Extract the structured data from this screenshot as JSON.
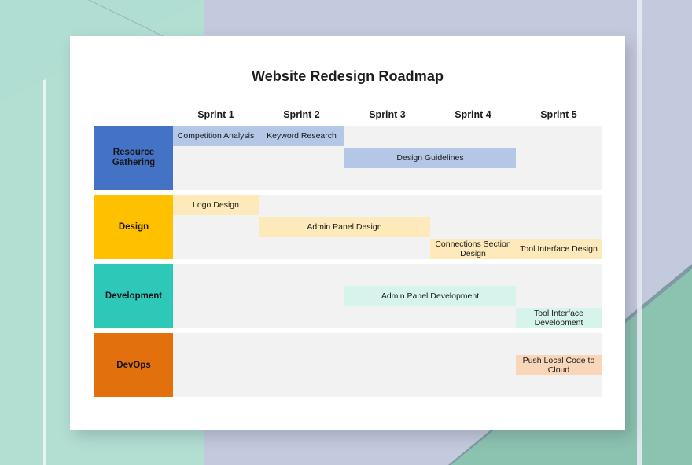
{
  "card": {
    "title": "Website Redesign Roadmap"
  },
  "colors": {
    "background_periwinkle": "#c4cadd",
    "background_mint": "#b3dfd3",
    "background_green_wedge": "#8cc2b0",
    "card_background": "#ffffff",
    "track_background": "#f2f2f2",
    "row_resource_gathering": "#4472c4",
    "row_design": "#ffc000",
    "row_development": "#2ec8b8",
    "row_devops": "#e2700d",
    "bar_resource_gathering": "#b4c7e7",
    "bar_design": "#fde9b9",
    "bar_development": "#d6f3ec",
    "bar_devops": "#fad6b8"
  },
  "chart_data": {
    "type": "bar",
    "title": "Website Redesign Roadmap",
    "xlabel": "",
    "ylabel": "",
    "categories": [
      "Sprint 1",
      "Sprint 2",
      "Sprint 3",
      "Sprint 4",
      "Sprint 5"
    ],
    "legend_position": "none",
    "grid": false,
    "series": [
      {
        "name": "Resource Gathering",
        "color": "#4472c4",
        "bar_color": "#b4c7e7",
        "values": [
          {
            "task": "Competition Analysis",
            "start_sprint": 1,
            "end_sprint": 1,
            "lane": 0
          },
          {
            "task": "Keyword Research",
            "start_sprint": 2,
            "end_sprint": 2,
            "lane": 0
          },
          {
            "task": "Design Guidelines",
            "start_sprint": 3,
            "end_sprint": 4,
            "lane": 1
          }
        ]
      },
      {
        "name": "Design",
        "color": "#ffc000",
        "bar_color": "#fde9b9",
        "values": [
          {
            "task": "Logo Design",
            "start_sprint": 1,
            "end_sprint": 1,
            "lane": 0
          },
          {
            "task": "Admin Panel Design",
            "start_sprint": 2,
            "end_sprint": 3,
            "lane": 1
          },
          {
            "task": "Connections Section Design",
            "start_sprint": 4,
            "end_sprint": 4,
            "lane": 2
          },
          {
            "task": "Tool Interface Design",
            "start_sprint": 5,
            "end_sprint": 5,
            "lane": 2
          }
        ]
      },
      {
        "name": "Development",
        "color": "#2ec8b8",
        "bar_color": "#d6f3ec",
        "values": [
          {
            "task": "Admin Panel Development",
            "start_sprint": 3,
            "end_sprint": 4,
            "lane": 1
          },
          {
            "task": "Tool Interface Development",
            "start_sprint": 5,
            "end_sprint": 5,
            "lane": 2
          }
        ]
      },
      {
        "name": "DevOps",
        "color": "#e2700d",
        "bar_color": "#fad6b8",
        "values": [
          {
            "task": "Push Local Code to Cloud",
            "start_sprint": 5,
            "end_sprint": 5,
            "lane": 1
          }
        ]
      }
    ]
  },
  "sprints": [
    {
      "label": "Sprint 1"
    },
    {
      "label": "Sprint 2"
    },
    {
      "label": "Sprint 3"
    },
    {
      "label": "Sprint 4"
    },
    {
      "label": "Sprint 5"
    }
  ],
  "rows": [
    {
      "label": "Resource Gathering",
      "label_color": "#4472c4",
      "bar_color": "#b4c7e7",
      "bars": [
        {
          "label": "Competition Analysis",
          "lane": 0,
          "start": 0,
          "span": 1
        },
        {
          "label": "Keyword Research",
          "lane": 0,
          "start": 1,
          "span": 1
        },
        {
          "label": "Design Guidelines",
          "lane": 1,
          "start": 2,
          "span": 2
        }
      ]
    },
    {
      "label": "Design",
      "label_color": "#ffc000",
      "bar_color": "#fde9b9",
      "bars": [
        {
          "label": "Logo Design",
          "lane": 0,
          "start": 0,
          "span": 1
        },
        {
          "label": "Admin Panel Design",
          "lane": 1,
          "start": 1,
          "span": 2
        },
        {
          "label": "Connections Section Design",
          "lane": 2,
          "start": 3,
          "span": 1
        },
        {
          "label": "Tool Interface Design",
          "lane": 2,
          "start": 4,
          "span": 1
        }
      ]
    },
    {
      "label": "Development",
      "label_color": "#2ec8b8",
      "bar_color": "#d6f3ec",
      "bars": [
        {
          "label": "Admin Panel Development",
          "lane": 1,
          "start": 2,
          "span": 2
        },
        {
          "label": "Tool Interface Development",
          "lane": 2,
          "start": 4,
          "span": 1
        }
      ]
    },
    {
      "label": "DevOps",
      "label_color": "#e2700d",
      "bar_color": "#fad6b8",
      "bars": [
        {
          "label": "Push Local Code to Cloud",
          "lane": 1,
          "start": 4,
          "span": 1
        }
      ]
    }
  ]
}
